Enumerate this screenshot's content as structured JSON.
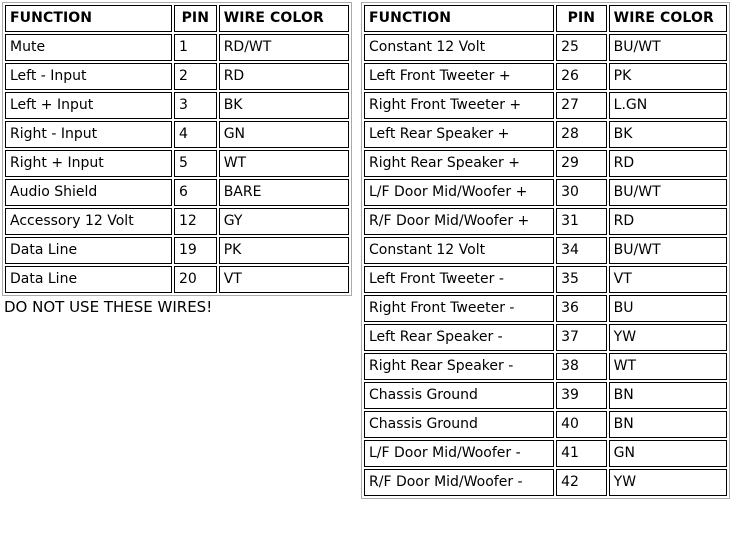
{
  "left_table": {
    "name": "audio-input-pins",
    "headers": [
      "FUNCTION",
      "PIN",
      "WIRE COLOR"
    ],
    "rows": [
      {
        "function": "Mute",
        "pin": "1",
        "color": "RD/WT",
        "tall": false
      },
      {
        "function": "Left - Input",
        "pin": "2",
        "color": "RD",
        "tall": false
      },
      {
        "function": "Left + Input",
        "pin": "3",
        "color": "BK",
        "tall": false
      },
      {
        "function": "Right - Input",
        "pin": "4",
        "color": "GN",
        "tall": false
      },
      {
        "function": "Right + Input",
        "pin": "5",
        "color": "WT",
        "tall": false
      },
      {
        "function": "Audio Shield",
        "pin": "6",
        "color": "BARE",
        "tall": false
      },
      {
        "function": "Accessory 12 Volt",
        "pin": "12",
        "color": "GY",
        "tall": false
      },
      {
        "function": "Data Line",
        "pin": "19",
        "color": "PK",
        "tall": false
      },
      {
        "function": "Data Line",
        "pin": "20",
        "color": "VT",
        "tall": false
      }
    ],
    "caption": "DO NOT USE THESE WIRES!"
  },
  "right_table": {
    "name": "power-speaker-pins",
    "headers": [
      "FUNCTION",
      "PIN",
      "WIRE COLOR"
    ],
    "rows": [
      {
        "function": "Constant 12 Volt",
        "pin": "25",
        "color": "BU/WT",
        "tall": false
      },
      {
        "function": "Left Front Tweeter +",
        "pin": "26",
        "color": "PK",
        "tall": false
      },
      {
        "function": "Right Front Tweeter +",
        "pin": "27",
        "color": "L.GN",
        "tall": true
      },
      {
        "function": "Left Rear Speaker +",
        "pin": "28",
        "color": "BK",
        "tall": false
      },
      {
        "function": "Right Rear Speaker +",
        "pin": "29",
        "color": "RD",
        "tall": false
      },
      {
        "function": "L/F Door Mid/Woofer +",
        "pin": "30",
        "color": "BU/WT",
        "tall": true
      },
      {
        "function": "R/F Door Mid/Woofer +",
        "pin": "31",
        "color": "RD",
        "tall": true
      },
      {
        "function": "Constant 12 Volt",
        "pin": "34",
        "color": "BU/WT",
        "tall": false
      },
      {
        "function": "Left Front Tweeter -",
        "pin": "35",
        "color": "VT",
        "tall": false
      },
      {
        "function": "Right Front Tweeter -",
        "pin": "36",
        "color": "BU",
        "tall": false
      },
      {
        "function": "Left Rear Speaker -",
        "pin": "37",
        "color": "YW",
        "tall": false
      },
      {
        "function": "Right Rear Speaker -",
        "pin": "38",
        "color": "WT",
        "tall": false
      },
      {
        "function": "Chassis Ground",
        "pin": "39",
        "color": "BN",
        "tall": false
      },
      {
        "function": "Chassis Ground",
        "pin": "40",
        "color": "BN",
        "tall": false
      },
      {
        "function": "L/F Door Mid/Woofer -",
        "pin": "41",
        "color": "GN",
        "tall": true
      },
      {
        "function": "R/F Door Mid/Woofer -",
        "pin": "42",
        "color": "YW",
        "tall": true
      }
    ]
  },
  "colors": {
    "page_background": "#ffffff",
    "text": "#000000",
    "cell_border": "#000000",
    "table_outer_border": "#aaaaaa"
  }
}
